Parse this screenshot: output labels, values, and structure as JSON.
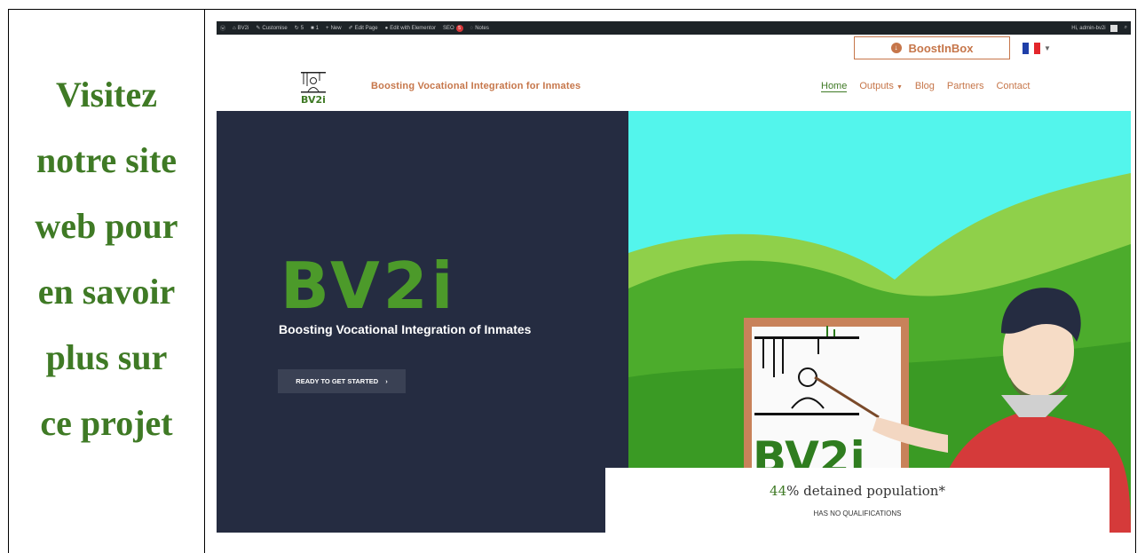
{
  "caption": {
    "lines": [
      "Visitez",
      "notre site",
      "web pour",
      "en savoir",
      "plus sur",
      "ce projet"
    ]
  },
  "admin_bar": {
    "site": "BV2i",
    "customise": "Customise",
    "updates": "5",
    "comments": "1",
    "new": "New",
    "edit_page": "Edit Page",
    "edit_elementor": "Edit with Elementor",
    "seo": "SEO",
    "seo_count": "5",
    "notes": "Notes",
    "user": "Hi, admin-bv2i"
  },
  "topbar": {
    "boost_button": "BoostInBox",
    "language": "FR"
  },
  "header": {
    "logo_text": "BV2i",
    "tagline": "Boosting Vocational Integration for Inmates"
  },
  "nav": {
    "home": "Home",
    "outputs": "Outputs",
    "blog": "Blog",
    "partners": "Partners",
    "contact": "Contact"
  },
  "hero": {
    "title": "BV2i",
    "subtitle": "Boosting Vocational Integration of Inmates",
    "cta": "READY TO GET STARTED"
  },
  "board": {
    "logo_text": "BV2i"
  },
  "stat": {
    "percent": "44",
    "text": "% detained population*",
    "sub": "HAS NO QUALIFICATIONS"
  },
  "colors": {
    "brand_green": "#4c9a2a",
    "accent_orange": "#c6764a",
    "hero_dark": "#252c41",
    "sky": "#53f5ec"
  }
}
